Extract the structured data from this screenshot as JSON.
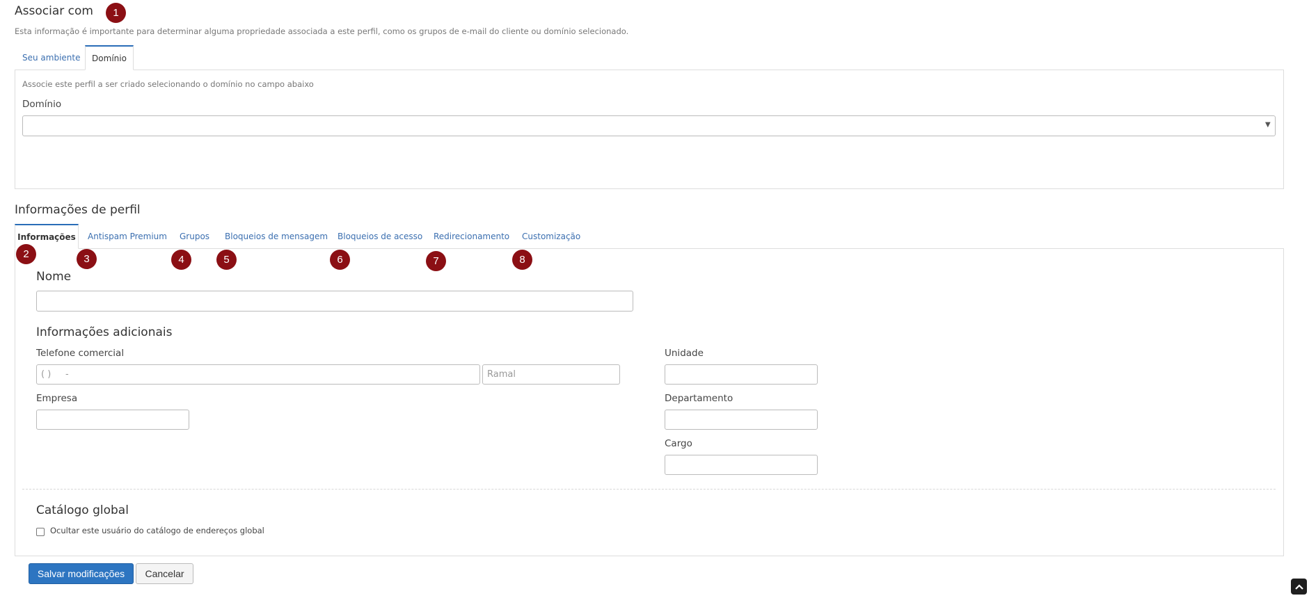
{
  "associate": {
    "title": "Associar com",
    "description": "Esta informação é importante para determinar alguma propriedade associada a este perfil, como os grupos de e-mail do cliente ou domínio selecionado.",
    "tabs": [
      {
        "label": "Seu ambiente",
        "active": false
      },
      {
        "label": "Domínio",
        "active": true
      }
    ],
    "panel_hint": "Associe este perfil a ser criado selecionando o domínio no campo abaixo",
    "domain_label": "Domínio",
    "domain_value": ""
  },
  "profile": {
    "title": "Informações de perfil",
    "tabs": [
      {
        "label": "Informações",
        "active": true
      },
      {
        "label": "Antispam Premium",
        "active": false
      },
      {
        "label": "Grupos",
        "active": false
      },
      {
        "label": "Bloqueios de mensagem",
        "active": false
      },
      {
        "label": "Bloqueios de acesso",
        "active": false
      },
      {
        "label": "Redirecionamento",
        "active": false
      },
      {
        "label": "Customização",
        "active": false
      }
    ],
    "name_heading": "Nome",
    "name_value": "",
    "additional_heading": "Informações adicionais",
    "phone_label": "Telefone comercial",
    "phone_placeholder": "( )     -",
    "ramal_placeholder": "Ramal",
    "company_label": "Empresa",
    "unit_label": "Unidade",
    "department_label": "Departamento",
    "role_label": "Cargo",
    "catalog_heading": "Catálogo global",
    "catalog_checkbox_label": "Ocultar este usuário do catálogo de endereços global",
    "catalog_checked": false
  },
  "actions": {
    "save_label": "Salvar modificações",
    "cancel_label": "Cancelar"
  },
  "badges": [
    "1",
    "2",
    "3",
    "4",
    "5",
    "6",
    "7",
    "8"
  ],
  "colors": {
    "badge": "#8b0f14",
    "link": "#3b6fb0",
    "primary": "#2d75c1",
    "tab_active_border": "#2a6db8"
  },
  "icons": {
    "select": "chevron-down-icon",
    "scroll_top": "chevron-up-icon"
  }
}
